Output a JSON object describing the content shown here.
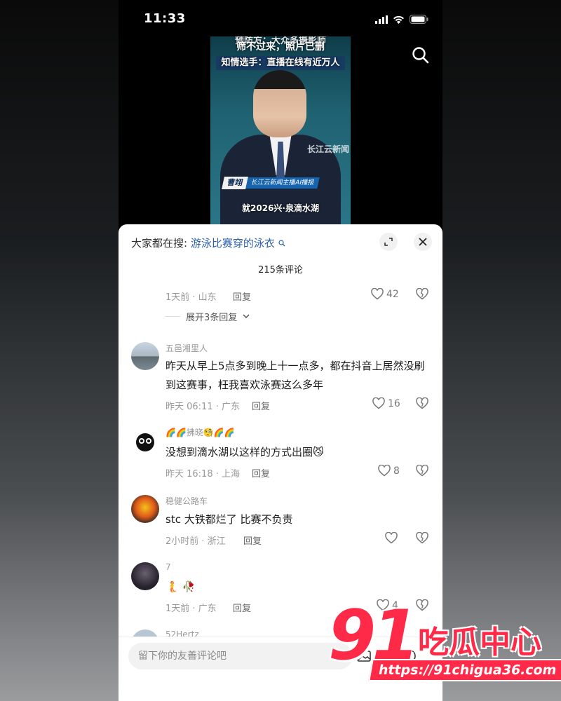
{
  "status_bar": {
    "time": "11:33"
  },
  "video": {
    "caption_top": "预防方：大众多摄影师",
    "caption_line2": "筛不过来，照片已删",
    "caption_line3": "知情选手：直播在线有近万人",
    "station_logo": "长江云新闻",
    "anchor_name": "曹翊",
    "anchor_title": "长江云新闻主播AI播报",
    "subtitle": "就2026兴·泉滴水湖"
  },
  "sheet": {
    "hot_search_label": "大家都在搜:",
    "hot_search_keyword": "游泳比赛穿的泳衣",
    "comment_count": "215条评论"
  },
  "partial_comment": {
    "meta": "1天前 · 山东",
    "reply": "回复",
    "likes": "42",
    "expand_replies": "展开3条回复"
  },
  "comments": [
    {
      "username": "五邑湘里人",
      "text": "昨天从早上5点多到晚上十一点多，都在抖音上居然没刷到这赛事，枉我喜欢泳赛这么多年",
      "meta": "昨天 06:11 · 广东",
      "reply": "回复",
      "likes": "16"
    },
    {
      "username": "🌈🌈拂晓🧐🌈🌈",
      "text": "没想到滴水湖以这样的方式出圈😼",
      "meta": "昨天 16:18 · 上海",
      "reply": "回复",
      "likes": "8"
    },
    {
      "username": "稳健公路车",
      "text": "stc 大铁都烂了  比赛不负责",
      "meta": "2小时前 · 浙江",
      "reply": "回复",
      "likes": ""
    },
    {
      "username": "7",
      "text": "🧜 🥀",
      "meta": "1天前 · 广东",
      "reply": "回复",
      "likes": "4"
    },
    {
      "username": "52Hertz"
    }
  ],
  "input": {
    "placeholder": "留下你的友善评论吧"
  },
  "watermark": {
    "number": "91",
    "name": "吃瓜中心",
    "url": "https://91chigua36.com"
  },
  "colors": {
    "accent_link": "#2b5fa6",
    "watermark_red": "#ff2a48"
  }
}
